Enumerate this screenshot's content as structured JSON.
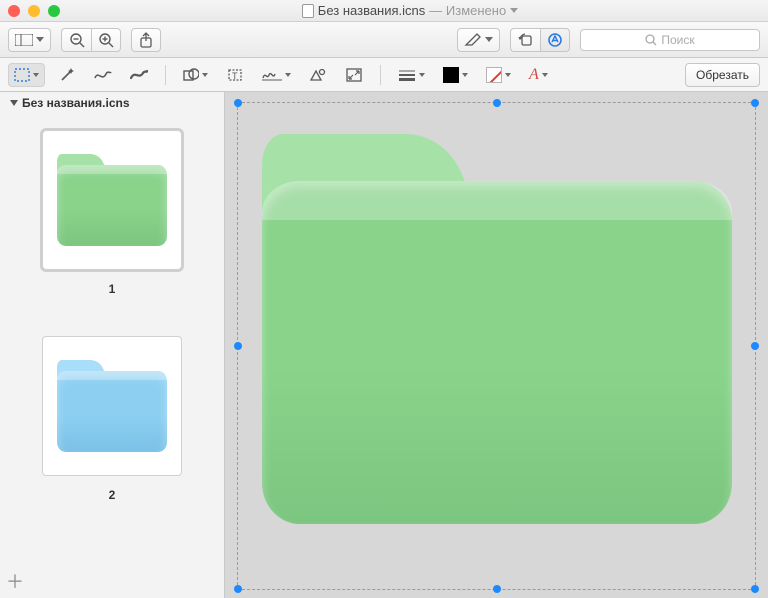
{
  "window": {
    "filename": "Без названия.icns",
    "status": "Изменено"
  },
  "toolbar": {
    "search_placeholder": "Поиск"
  },
  "edit_toolbar": {
    "crop_label": "Обрезать",
    "font_letter": "A"
  },
  "sidebar": {
    "header": "Без названия.icns",
    "thumbs": [
      {
        "label": "1",
        "color": "green",
        "selected": true
      },
      {
        "label": "2",
        "color": "blue",
        "selected": false
      }
    ]
  },
  "canvas": {
    "folder_color": "green"
  }
}
